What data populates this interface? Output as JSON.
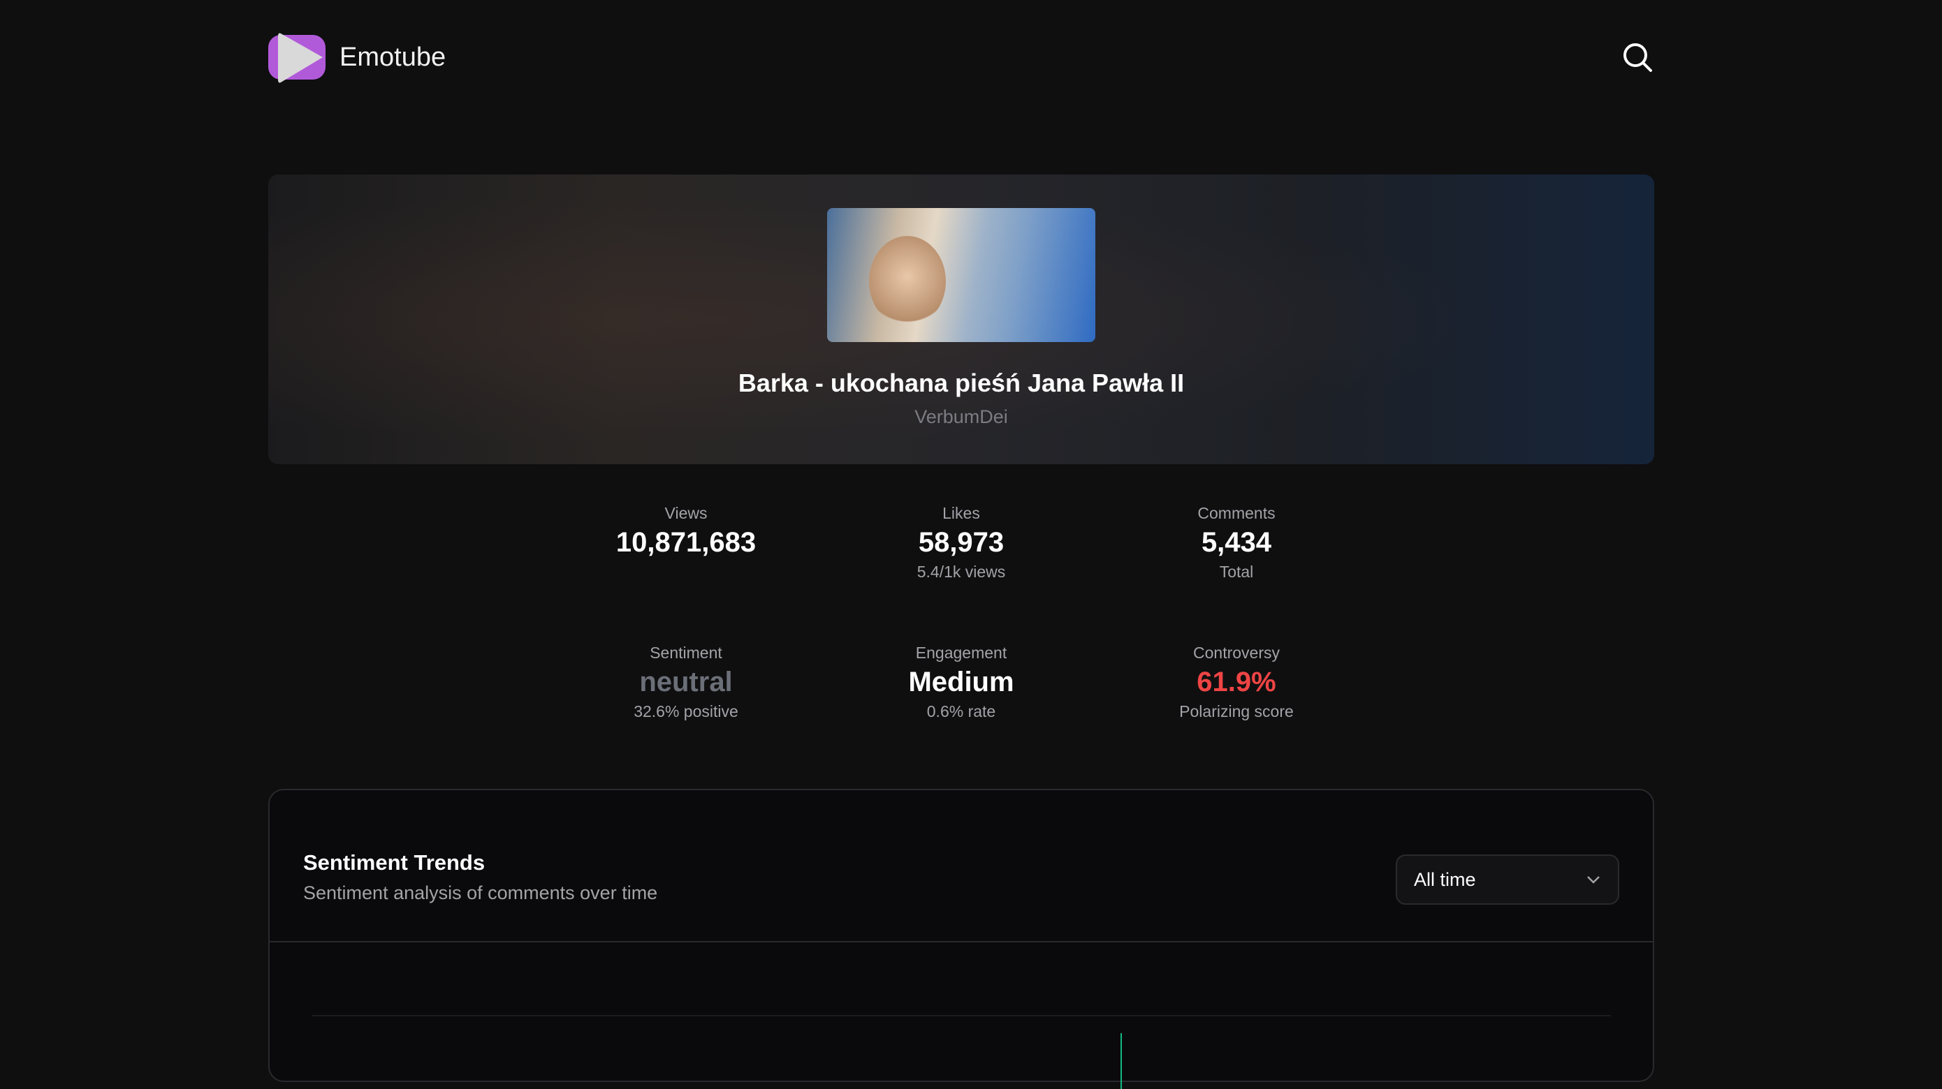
{
  "header": {
    "brand": "Emotube",
    "logo_color": "#b15ad9",
    "search_icon": "search-icon"
  },
  "video": {
    "title": "Barka - ukochana pieśń Jana Pawła II",
    "channel": "VerbumDei"
  },
  "stats": [
    {
      "label": "Views",
      "value": "10,871,683",
      "sub": ""
    },
    {
      "label": "Likes",
      "value": "58,973",
      "sub": "5.4/1k views"
    },
    {
      "label": "Comments",
      "value": "5,434",
      "sub": "Total"
    },
    {
      "label": "Sentiment",
      "value": "neutral",
      "sub": "32.6% positive",
      "color": "#6b6f78"
    },
    {
      "label": "Engagement",
      "value": "Medium",
      "sub": "0.6% rate"
    },
    {
      "label": "Controversy",
      "value": "61.9%",
      "sub": "Polarizing score",
      "color": "#ef4444"
    }
  ],
  "trends": {
    "title": "Sentiment Trends",
    "subtitle": "Sentiment analysis of comments over time",
    "range": "All time",
    "accent": "#10b981"
  }
}
